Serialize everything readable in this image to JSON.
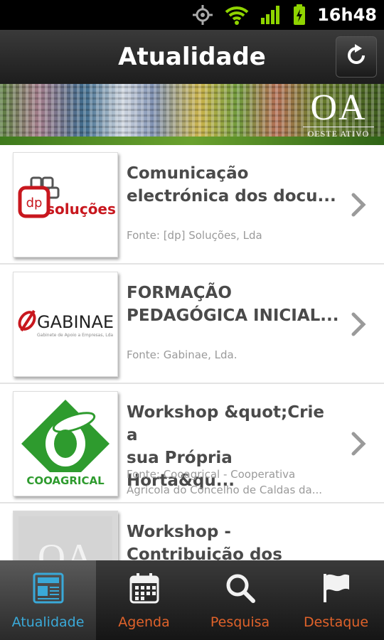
{
  "status_bar": {
    "time": "16h48"
  },
  "header": {
    "title": "Atualidade"
  },
  "banner": {
    "logo_big": "OA",
    "logo_sub": "OESTE ATIVO"
  },
  "news": [
    {
      "title": "Comunicação\nelectrónica dos docu...",
      "source": "Fonte: [dp] Soluções, Lda",
      "logo": {
        "top": "dp",
        "bottom": "soluções"
      }
    },
    {
      "title": "FORMAÇÃO\nPEDAGÓGICA INICIAL...",
      "source": "Fonte: Gabinae, Lda.",
      "logo": {
        "name": "GABINAE",
        "tagline": "Gabinete de Apoio a Empresas, Lda"
      }
    },
    {
      "title": "Workshop &quot;Crie a\nsua Própria Horta&qu...",
      "source": "Fonte: Cooagrical - Cooperativa\nAgrícola do Concelho de Caldas da...",
      "logo": {
        "name": "COOAGRICAL"
      }
    },
    {
      "title": "Workshop -\nContribuição dos mét...",
      "source": "",
      "logo": {
        "name": "OA"
      }
    }
  ],
  "tabs": [
    {
      "label": "Atualidade",
      "icon": "news-icon",
      "active": true
    },
    {
      "label": "Agenda",
      "icon": "calendar-icon",
      "active": false
    },
    {
      "label": "Pesquisa",
      "icon": "search-icon",
      "active": false
    },
    {
      "label": "Destaque",
      "icon": "flag-icon",
      "active": false
    }
  ],
  "colors": {
    "active_tab": "#3aa9d8",
    "inactive_tab": "#e0622a",
    "headline": "#4a4a4a",
    "source": "#9a9a9a"
  }
}
